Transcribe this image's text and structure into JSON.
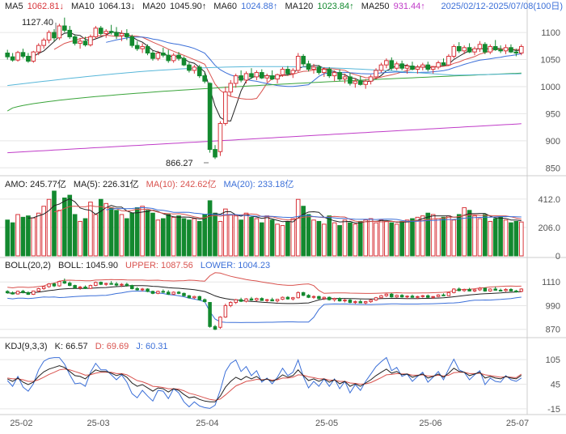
{
  "colors": {
    "up": "#d8343a",
    "down": "#13892f",
    "ma5": "#222222",
    "ma10": "#d9534f",
    "ma20": "#3b6fd8",
    "ma60": "#3aa43a",
    "ma120": "#58b7d9",
    "ma250": "#c03cc8",
    "boll_mid": "#222222",
    "boll_upper": "#d9534f",
    "boll_lower": "#3b6fd8",
    "kdj_k": "#222222",
    "kdj_d": "#d9534f",
    "kdj_j": "#3b6fd8",
    "amo_ma5": "#222222",
    "amo_ma10": "#d9534f",
    "amo_ma20": "#3b6fd8",
    "grid": "#e6e6e6",
    "axis_text": "#555555"
  },
  "header": {
    "ma5_label": "MA5",
    "ma5_value": "1062.81↓",
    "ma10_label": "MA10",
    "ma10_value": "1064.13↓",
    "ma20_label": "MA20",
    "ma20_value": "1045.90↑",
    "ma60_label": "MA60",
    "ma60_value": "1024.88↑",
    "ma120_label": "MA120",
    "ma120_value": "1023.84↑",
    "ma250_label": "MA250",
    "ma250_value": "931.44↑",
    "range": "2025/02/12-2025/07/08(100日)"
  },
  "amo_header": {
    "amo": "AMO: 245.77亿",
    "ma5": "MA(5): 226.31亿",
    "ma10": "MA(10): 242.62亿",
    "ma20": "MA(20): 233.18亿"
  },
  "boll_header": {
    "title": "BOLL(20,2)",
    "mid": "BOLL: 1045.90",
    "upper": "UPPER: 1087.56",
    "lower": "LOWER: 1004.23"
  },
  "kdj_header": {
    "title": "KDJ(9,3,3)",
    "k": "K: 66.57",
    "d": "D: 69.69",
    "j": "J: 60.31"
  },
  "annotations": {
    "high": "1127.40",
    "low": "866.27"
  },
  "chart_data": {
    "type": "candlestick",
    "x_axis_labels": [
      "25-02",
      "25-03",
      "25-04",
      "25-05",
      "25-06",
      "25-07"
    ],
    "price": {
      "ticks": [
        850,
        900,
        950,
        1000,
        1050,
        1100
      ],
      "ylim": [
        840,
        1130
      ],
      "ohlc": [
        [
          1062.0,
          1068.0,
          1050.0,
          1055.0
        ],
        [
          1055.0,
          1062.0,
          1046.0,
          1049.0
        ],
        [
          1049.0,
          1066.0,
          1046.0,
          1063.0
        ],
        [
          1063.0,
          1070.0,
          1052.0,
          1056.0
        ],
        [
          1056.0,
          1062.0,
          1044.0,
          1047.0
        ],
        [
          1047.0,
          1066.0,
          1044.0,
          1064.0
        ],
        [
          1064.0,
          1080.0,
          1058.0,
          1076.0
        ],
        [
          1076.0,
          1090.0,
          1070.0,
          1086.0
        ],
        [
          1086.0,
          1104.0,
          1080.0,
          1100.0
        ],
        [
          1100.0,
          1106.0,
          1084.0,
          1090.0
        ],
        [
          1090.0,
          1116.0,
          1086.0,
          1112.0
        ],
        [
          1112.0,
          1127.4,
          1100.0,
          1104.0
        ],
        [
          1104.0,
          1112.0,
          1088.0,
          1092.0
        ],
        [
          1092.0,
          1096.0,
          1076.0,
          1080.0
        ],
        [
          1080.0,
          1090.0,
          1070.0,
          1084.0
        ],
        [
          1084.0,
          1092.0,
          1074.0,
          1077.0
        ],
        [
          1077.0,
          1096.0,
          1074.0,
          1092.0
        ],
        [
          1092.0,
          1112.0,
          1088.0,
          1108.0
        ],
        [
          1108.0,
          1112.0,
          1094.0,
          1098.0
        ],
        [
          1098.0,
          1106.0,
          1090.0,
          1102.0
        ],
        [
          1102.0,
          1114.0,
          1096.0,
          1100.0
        ],
        [
          1100.0,
          1110.0,
          1088.0,
          1094.0
        ],
        [
          1094.0,
          1104.0,
          1084.0,
          1098.0
        ],
        [
          1098.0,
          1106.0,
          1086.0,
          1092.0
        ],
        [
          1092.0,
          1096.0,
          1072.0,
          1076.0
        ],
        [
          1076.0,
          1084.0,
          1066.0,
          1070.0
        ],
        [
          1070.0,
          1080.0,
          1062.0,
          1074.0
        ],
        [
          1074.0,
          1078.0,
          1058.0,
          1062.0
        ],
        [
          1062.0,
          1066.0,
          1048.0,
          1052.0
        ],
        [
          1052.0,
          1066.0,
          1048.0,
          1062.0
        ],
        [
          1062.0,
          1072.0,
          1054.0,
          1058.0
        ],
        [
          1058.0,
          1068.0,
          1044.0,
          1048.0
        ],
        [
          1048.0,
          1062.0,
          1044.0,
          1058.0
        ],
        [
          1058.0,
          1064.0,
          1048.0,
          1052.0
        ],
        [
          1052.0,
          1056.0,
          1038.0,
          1040.0
        ],
        [
          1040.0,
          1044.0,
          1026.0,
          1030.0
        ],
        [
          1030.0,
          1040.0,
          1024.0,
          1036.0
        ],
        [
          1036.0,
          1040.0,
          1016.0,
          1020.0
        ],
        [
          1020.0,
          1026.0,
          1006.0,
          1010.0
        ],
        [
          1006.0,
          1008.0,
          878.0,
          884.0
        ],
        [
          884.0,
          892.0,
          866.27,
          870.0
        ],
        [
          880.0,
          936.0,
          872.0,
          932.0
        ],
        [
          932.0,
          1000.0,
          928.0,
          990.0
        ],
        [
          990.0,
          1012.0,
          982.0,
          1006.0
        ],
        [
          1006.0,
          1024.0,
          998.0,
          1020.0
        ],
        [
          1020.0,
          1030.0,
          1008.0,
          1012.0
        ],
        [
          1012.0,
          1028.0,
          1006.0,
          1024.0
        ],
        [
          1024.0,
          1034.0,
          1014.0,
          1018.0
        ],
        [
          1018.0,
          1030.0,
          1012.0,
          1026.0
        ],
        [
          1026.0,
          1032.0,
          1014.0,
          1016.0
        ],
        [
          1016.0,
          1024.0,
          1008.0,
          1020.0
        ],
        [
          1020.0,
          1030.0,
          1012.0,
          1014.0
        ],
        [
          1014.0,
          1024.0,
          1006.0,
          1022.0
        ],
        [
          1022.0,
          1036.0,
          1018.0,
          1032.0
        ],
        [
          1032.0,
          1038.0,
          1020.0,
          1024.0
        ],
        [
          1024.0,
          1034.0,
          1016.0,
          1030.0
        ],
        [
          1030.0,
          1062.0,
          1026.0,
          1056.0
        ],
        [
          1056.0,
          1060.0,
          1038.0,
          1042.0
        ],
        [
          1042.0,
          1048.0,
          1028.0,
          1032.0
        ],
        [
          1032.0,
          1042.0,
          1024.0,
          1036.0
        ],
        [
          1036.0,
          1040.0,
          1022.0,
          1026.0
        ],
        [
          1026.0,
          1036.0,
          1018.0,
          1032.0
        ],
        [
          1032.0,
          1036.0,
          1016.0,
          1020.0
        ],
        [
          1020.0,
          1030.0,
          1010.0,
          1026.0
        ],
        [
          1026.0,
          1032.0,
          1010.0,
          1014.0
        ],
        [
          1014.0,
          1024.0,
          1006.0,
          1018.0
        ],
        [
          1018.0,
          1026.0,
          1002.0,
          1006.0
        ],
        [
          1006.0,
          1016.0,
          998.0,
          1010.0
        ],
        [
          1010.0,
          1020.0,
          1002.0,
          1004.0
        ],
        [
          1004.0,
          1014.0,
          996.0,
          1010.0
        ],
        [
          1010.0,
          1022.0,
          1004.0,
          1018.0
        ],
        [
          1018.0,
          1034.0,
          1014.0,
          1030.0
        ],
        [
          1030.0,
          1044.0,
          1026.0,
          1040.0
        ],
        [
          1040.0,
          1052.0,
          1034.0,
          1048.0
        ],
        [
          1048.0,
          1054.0,
          1030.0,
          1034.0
        ],
        [
          1034.0,
          1046.0,
          1030.0,
          1042.0
        ],
        [
          1042.0,
          1048.0,
          1030.0,
          1034.0
        ],
        [
          1034.0,
          1042.0,
          1024.0,
          1038.0
        ],
        [
          1038.0,
          1046.0,
          1030.0,
          1032.0
        ],
        [
          1032.0,
          1040.0,
          1024.0,
          1036.0
        ],
        [
          1036.0,
          1044.0,
          1030.0,
          1040.0
        ],
        [
          1040.0,
          1046.0,
          1028.0,
          1032.0
        ],
        [
          1032.0,
          1038.0,
          1024.0,
          1036.0
        ],
        [
          1036.0,
          1048.0,
          1032.0,
          1044.0
        ],
        [
          1044.0,
          1052.0,
          1038.0,
          1040.0
        ],
        [
          1040.0,
          1060.0,
          1038.0,
          1056.0
        ],
        [
          1056.0,
          1078.0,
          1052.0,
          1074.0
        ],
        [
          1074.0,
          1082.0,
          1062.0,
          1066.0
        ],
        [
          1066.0,
          1076.0,
          1060.0,
          1072.0
        ],
        [
          1072.0,
          1080.0,
          1062.0,
          1064.0
        ],
        [
          1064.0,
          1074.0,
          1058.0,
          1070.0
        ],
        [
          1070.0,
          1084.0,
          1064.0,
          1078.0
        ],
        [
          1078.0,
          1082.0,
          1060.0,
          1064.0
        ],
        [
          1064.0,
          1078.0,
          1060.0,
          1074.0
        ],
        [
          1074.0,
          1086.0,
          1066.0,
          1068.0
        ],
        [
          1068.0,
          1076.0,
          1062.0,
          1066.0
        ],
        [
          1066.0,
          1078.0,
          1060.0,
          1072.0
        ],
        [
          1072.0,
          1078.0,
          1062.0,
          1064.0
        ],
        [
          1064.0,
          1070.0,
          1056.0,
          1062.0
        ],
        [
          1062.0,
          1078.0,
          1058.0,
          1074.0
        ]
      ]
    },
    "amo": {
      "ticks": [
        0,
        206.0,
        412.0
      ],
      "ylim": [
        0,
        470
      ],
      "values": [
        260,
        240,
        300,
        280,
        290,
        275,
        310,
        360,
        410,
        470,
        330,
        420,
        440,
        300,
        250,
        270,
        390,
        300,
        410,
        380,
        350,
        330,
        300,
        270,
        310,
        350,
        360,
        330,
        310,
        260,
        270,
        300,
        280,
        290,
        270,
        260,
        270,
        250,
        300,
        400,
        310,
        250,
        340,
        300,
        290,
        260,
        310,
        280,
        270,
        240,
        290,
        260,
        230,
        220,
        250,
        270,
        410,
        360,
        300,
        260,
        250,
        230,
        290,
        240,
        220,
        260,
        240,
        230,
        250,
        260,
        270,
        240,
        260,
        250,
        240,
        230,
        250,
        260,
        270,
        280,
        290,
        310,
        300,
        270,
        280,
        290,
        260,
        300,
        350,
        330,
        290,
        270,
        300,
        250,
        270,
        280,
        260,
        240,
        250,
        245.77
      ]
    },
    "boll": {
      "ticks": [
        870,
        990,
        1110
      ],
      "ylim": [
        840,
        1160
      ]
    },
    "kdj": {
      "ticks": [
        -15,
        45,
        105
      ],
      "ylim": [
        -25,
        125
      ],
      "k": [
        58,
        52,
        60,
        50,
        44,
        50,
        64,
        75,
        82,
        86,
        90,
        86,
        76,
        66,
        64,
        58,
        70,
        80,
        76,
        76,
        72,
        66,
        70,
        62,
        48,
        40,
        44,
        36,
        28,
        36,
        34,
        26,
        34,
        30,
        20,
        12,
        14,
        8,
        4,
        2,
        2,
        16,
        38,
        52,
        62,
        56,
        64,
        58,
        64,
        54,
        58,
        52,
        58,
        68,
        62,
        66,
        80,
        66,
        54,
        58,
        52,
        58,
        50,
        56,
        46,
        52,
        40,
        46,
        40,
        48,
        56,
        66,
        74,
        82,
        72,
        76,
        68,
        70,
        62,
        66,
        70,
        60,
        64,
        70,
        62,
        72,
        84,
        76,
        74,
        66,
        70,
        74,
        60,
        64,
        60,
        58,
        64,
        60,
        58,
        66.57
      ],
      "d": [
        60,
        58,
        58,
        56,
        52,
        52,
        56,
        62,
        69,
        74,
        80,
        82,
        80,
        76,
        72,
        67,
        68,
        72,
        74,
        74,
        74,
        71,
        71,
        68,
        61,
        54,
        51,
        46,
        40,
        39,
        37,
        34,
        34,
        33,
        29,
        23,
        20,
        16,
        12,
        8,
        6,
        9,
        19,
        30,
        41,
        46,
        52,
        54,
        57,
        56,
        57,
        55,
        56,
        60,
        60,
        62,
        68,
        67,
        63,
        61,
        58,
        58,
        55,
        55,
        52,
        52,
        48,
        47,
        45,
        46,
        49,
        55,
        61,
        68,
        69,
        71,
        70,
        70,
        67,
        67,
        68,
        65,
        65,
        67,
        65,
        67,
        73,
        74,
        74,
        71,
        71,
        72,
        68,
        66,
        64,
        62,
        63,
        62,
        61,
        69.69
      ],
      "j": [
        54,
        40,
        64,
        38,
        28,
        46,
        80,
        101,
        108,
        110,
        110,
        94,
        68,
        46,
        48,
        40,
        74,
        96,
        80,
        80,
        68,
        56,
        68,
        50,
        22,
        12,
        30,
        16,
        4,
        30,
        28,
        10,
        34,
        24,
        2,
        -10,
        2,
        -8,
        -12,
        -14,
        -6,
        30,
        76,
        96,
        104,
        76,
        88,
        66,
        78,
        50,
        60,
        46,
        62,
        84,
        66,
        74,
        104,
        64,
        36,
        52,
        40,
        58,
        40,
        58,
        34,
        52,
        24,
        44,
        30,
        52,
        70,
        88,
        100,
        110,
        78,
        86,
        64,
        70,
        52,
        64,
        74,
        50,
        62,
        76,
        56,
        82,
        106,
        80,
        74,
        56,
        68,
        78,
        44,
        60,
        52,
        50,
        66,
        56,
        52,
        60.31
      ]
    }
  }
}
